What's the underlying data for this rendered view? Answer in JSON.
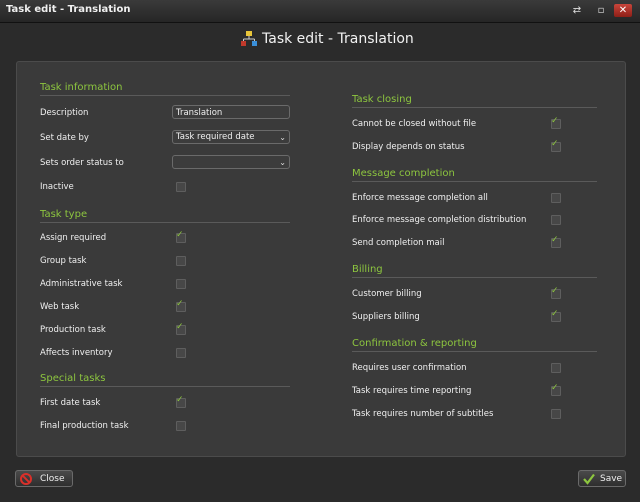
{
  "window": {
    "title": "Task edit - Translation"
  },
  "header": {
    "title": "Task edit - Translation"
  },
  "task_information": {
    "heading": "Task information",
    "description_label": "Description",
    "description_value": "Translation",
    "set_date_by_label": "Set date by",
    "set_date_by_value": "Task required date",
    "sets_order_status_label": "Sets order status to",
    "sets_order_status_value": "",
    "inactive_label": "Inactive",
    "inactive_checked": false
  },
  "task_type": {
    "heading": "Task type",
    "items": [
      {
        "label": "Assign required",
        "checked": true
      },
      {
        "label": "Group task",
        "checked": false
      },
      {
        "label": "Administrative task",
        "checked": false
      },
      {
        "label": "Web task",
        "checked": true
      },
      {
        "label": "Production task",
        "checked": true
      },
      {
        "label": "Affects inventory",
        "checked": false
      }
    ]
  },
  "special_tasks": {
    "heading": "Special tasks",
    "items": [
      {
        "label": "First date task",
        "checked": true
      },
      {
        "label": "Final production task",
        "checked": false
      }
    ]
  },
  "task_closing": {
    "heading": "Task closing",
    "items": [
      {
        "label": "Cannot be closed without file",
        "checked": true
      },
      {
        "label": "Display depends on status",
        "checked": true
      }
    ]
  },
  "message_completion": {
    "heading": "Message completion",
    "items": [
      {
        "label": "Enforce message completion all",
        "checked": false
      },
      {
        "label": "Enforce message completion distribution",
        "checked": false
      },
      {
        "label": "Send completion mail",
        "checked": true
      }
    ]
  },
  "billing": {
    "heading": "Billing",
    "items": [
      {
        "label": "Customer billing",
        "checked": true
      },
      {
        "label": "Suppliers billing",
        "checked": true
      }
    ]
  },
  "confirmation": {
    "heading": "Confirmation & reporting",
    "items": [
      {
        "label": "Requires user confirmation",
        "checked": false
      },
      {
        "label": "Task requires time reporting",
        "checked": true
      },
      {
        "label": "Task requires number of subtitles",
        "checked": false
      }
    ]
  },
  "footer": {
    "close_label": "Close",
    "save_label": "Save"
  },
  "colors": {
    "accent": "#8dc63f",
    "close_red": "#d9302a"
  }
}
